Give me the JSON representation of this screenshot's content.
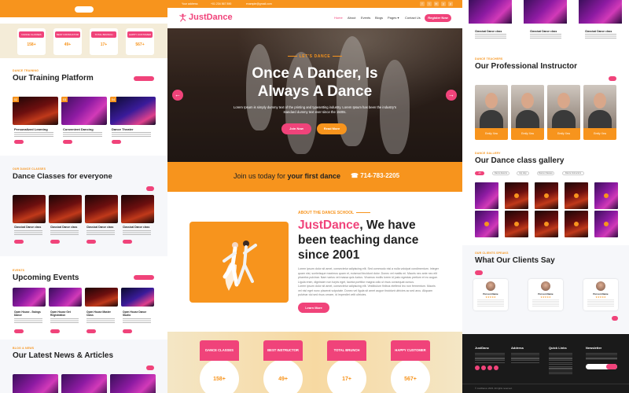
{
  "left": {
    "stats": [
      {
        "label": "DANCE CLASSES",
        "value": "158+"
      },
      {
        "label": "BEST INSTRUCTOR",
        "value": "49+"
      },
      {
        "label": "TOTAL BRUNCH",
        "value": "17+"
      },
      {
        "label": "HAPPY CUSTOMER",
        "value": "567+"
      }
    ],
    "training": {
      "kicker": "DANCE TRAINING",
      "title": "Our Training Platform",
      "badges": [
        "02",
        "03",
        "04"
      ],
      "cards": [
        "Personalized Learning",
        "Convenient Dancing",
        "Dance Theater"
      ]
    },
    "classes": {
      "kicker": "OUR DANCE CLASSES",
      "title": "Dance Classes for everyone",
      "cards": [
        "Classical Dance class",
        "Classical Dance class",
        "Classical Dance class",
        "Classical Dance class"
      ]
    },
    "events": {
      "kicker": "EVENTS",
      "title": "Upcoming Events",
      "cards": [
        "Open House - Swings Dance",
        "Open House Get Registration",
        "Open House Master Class",
        "Open House Dance Studio"
      ]
    },
    "news": {
      "kicker": "BLOG & NEWS",
      "title": "Our Latest News & Articles"
    }
  },
  "center": {
    "topbar": {
      "address": "Your address",
      "phone": "+01 234 567 890",
      "email": "example@gmail.com",
      "social": [
        "f",
        "t",
        "in",
        "y",
        "p"
      ]
    },
    "brand": "JustDance",
    "nav": [
      "Home",
      "About",
      "Events",
      "Blogs",
      "Pages ▾",
      "Contact Us"
    ],
    "register_label": "Register Now",
    "hero": {
      "kicker": "LET'S DANCE",
      "title_line1": "Once A Dancer, Is",
      "title_line2": "Always A Dance",
      "text": "Lorem Ipsum is simply dummy text of the printing and typesetting industry. Lorem Ipsum has been the industry's standard dummy text ever since the 1500s.",
      "btn1": "Join Now",
      "btn2": "Read More",
      "prev": "←",
      "next": "→"
    },
    "join": {
      "text_pre": "Join us today for ",
      "text_bold": "your first dance",
      "phone_icon": "☎",
      "phone": "714-783-2205"
    },
    "about": {
      "kicker": "ABOUT THE DANCE SCHOOL",
      "brand": "JustDance",
      "title_rest": ", We have been teaching dance since 2001",
      "p1": "Lorem ipsum dolor sit amet, consectetur adipiscing elit. Sed commodo nisl a nulla volutpat condimentum. Integer quam nisi, scelerisque maximus quam et, euismod tincidunt dolor. Donec vel mattis mi. Mauris nec ante nec elit pharetra pulvinar. Nam varius vel massa quis luctus. Vivamus mollis lorem id justo egestas pretium et eu augue. Ligula enim, dignissim non turpis eget, lacinia porttitor magna odio ut risus consequat cursus.",
      "p2": "Lorem ipsum dolor sit amet, consectetur adipiscing elit. Vestibulum finibus eleifend leo non fermentum. Mauris vel nisl eget nunc placerat vulputate. Donec vel ligula sit amet augue tincidunt ultricies ac sed arcu. Aliquam pulvinar dui sed risus ornare, id imperdiet velit ultricies.",
      "btn": "Learn More"
    },
    "stats": [
      {
        "label": "DANCE CLASSES",
        "value": "158+"
      },
      {
        "label": "BEST INSTRUCTOR",
        "value": "49+"
      },
      {
        "label": "TOTAL BRUNCH",
        "value": "17+"
      },
      {
        "label": "HAPPY CUSTOMER",
        "value": "567+"
      }
    ]
  },
  "right": {
    "top_cards": [
      "Classical Dance class",
      "Classical Dance class",
      "Classical Dance class"
    ],
    "instructors": {
      "kicker": "DANCE TEACHERS",
      "title": "Our Professional Instructor",
      "names": [
        "Emily Xea",
        "Emily Xea",
        "Emily Xea",
        "Emily Xea"
      ]
    },
    "gallery": {
      "kicker": "DANCE GALLERY",
      "title": "Our Dance class gallery",
      "tabs": [
        "All",
        "Dance Events",
        "Hip Hop",
        "Dance Classes",
        "Dance Instructors"
      ]
    },
    "clients": {
      "kicker": "OUR CLIENTS SPEAKS",
      "title": "What Our Clients Say",
      "names": [
        "Person Name",
        "Person Name",
        "Person Name"
      ],
      "stars": "★★★★★"
    },
    "footer": {
      "cols": [
        "JustDanc",
        "Address",
        "Quick Links",
        "Newsletter"
      ],
      "copyright": "© JustDance 2023. All rights reserved."
    }
  },
  "colors": {
    "primary": "#f0437a",
    "accent": "#f7941d",
    "dark": "#1a1a1a"
  }
}
